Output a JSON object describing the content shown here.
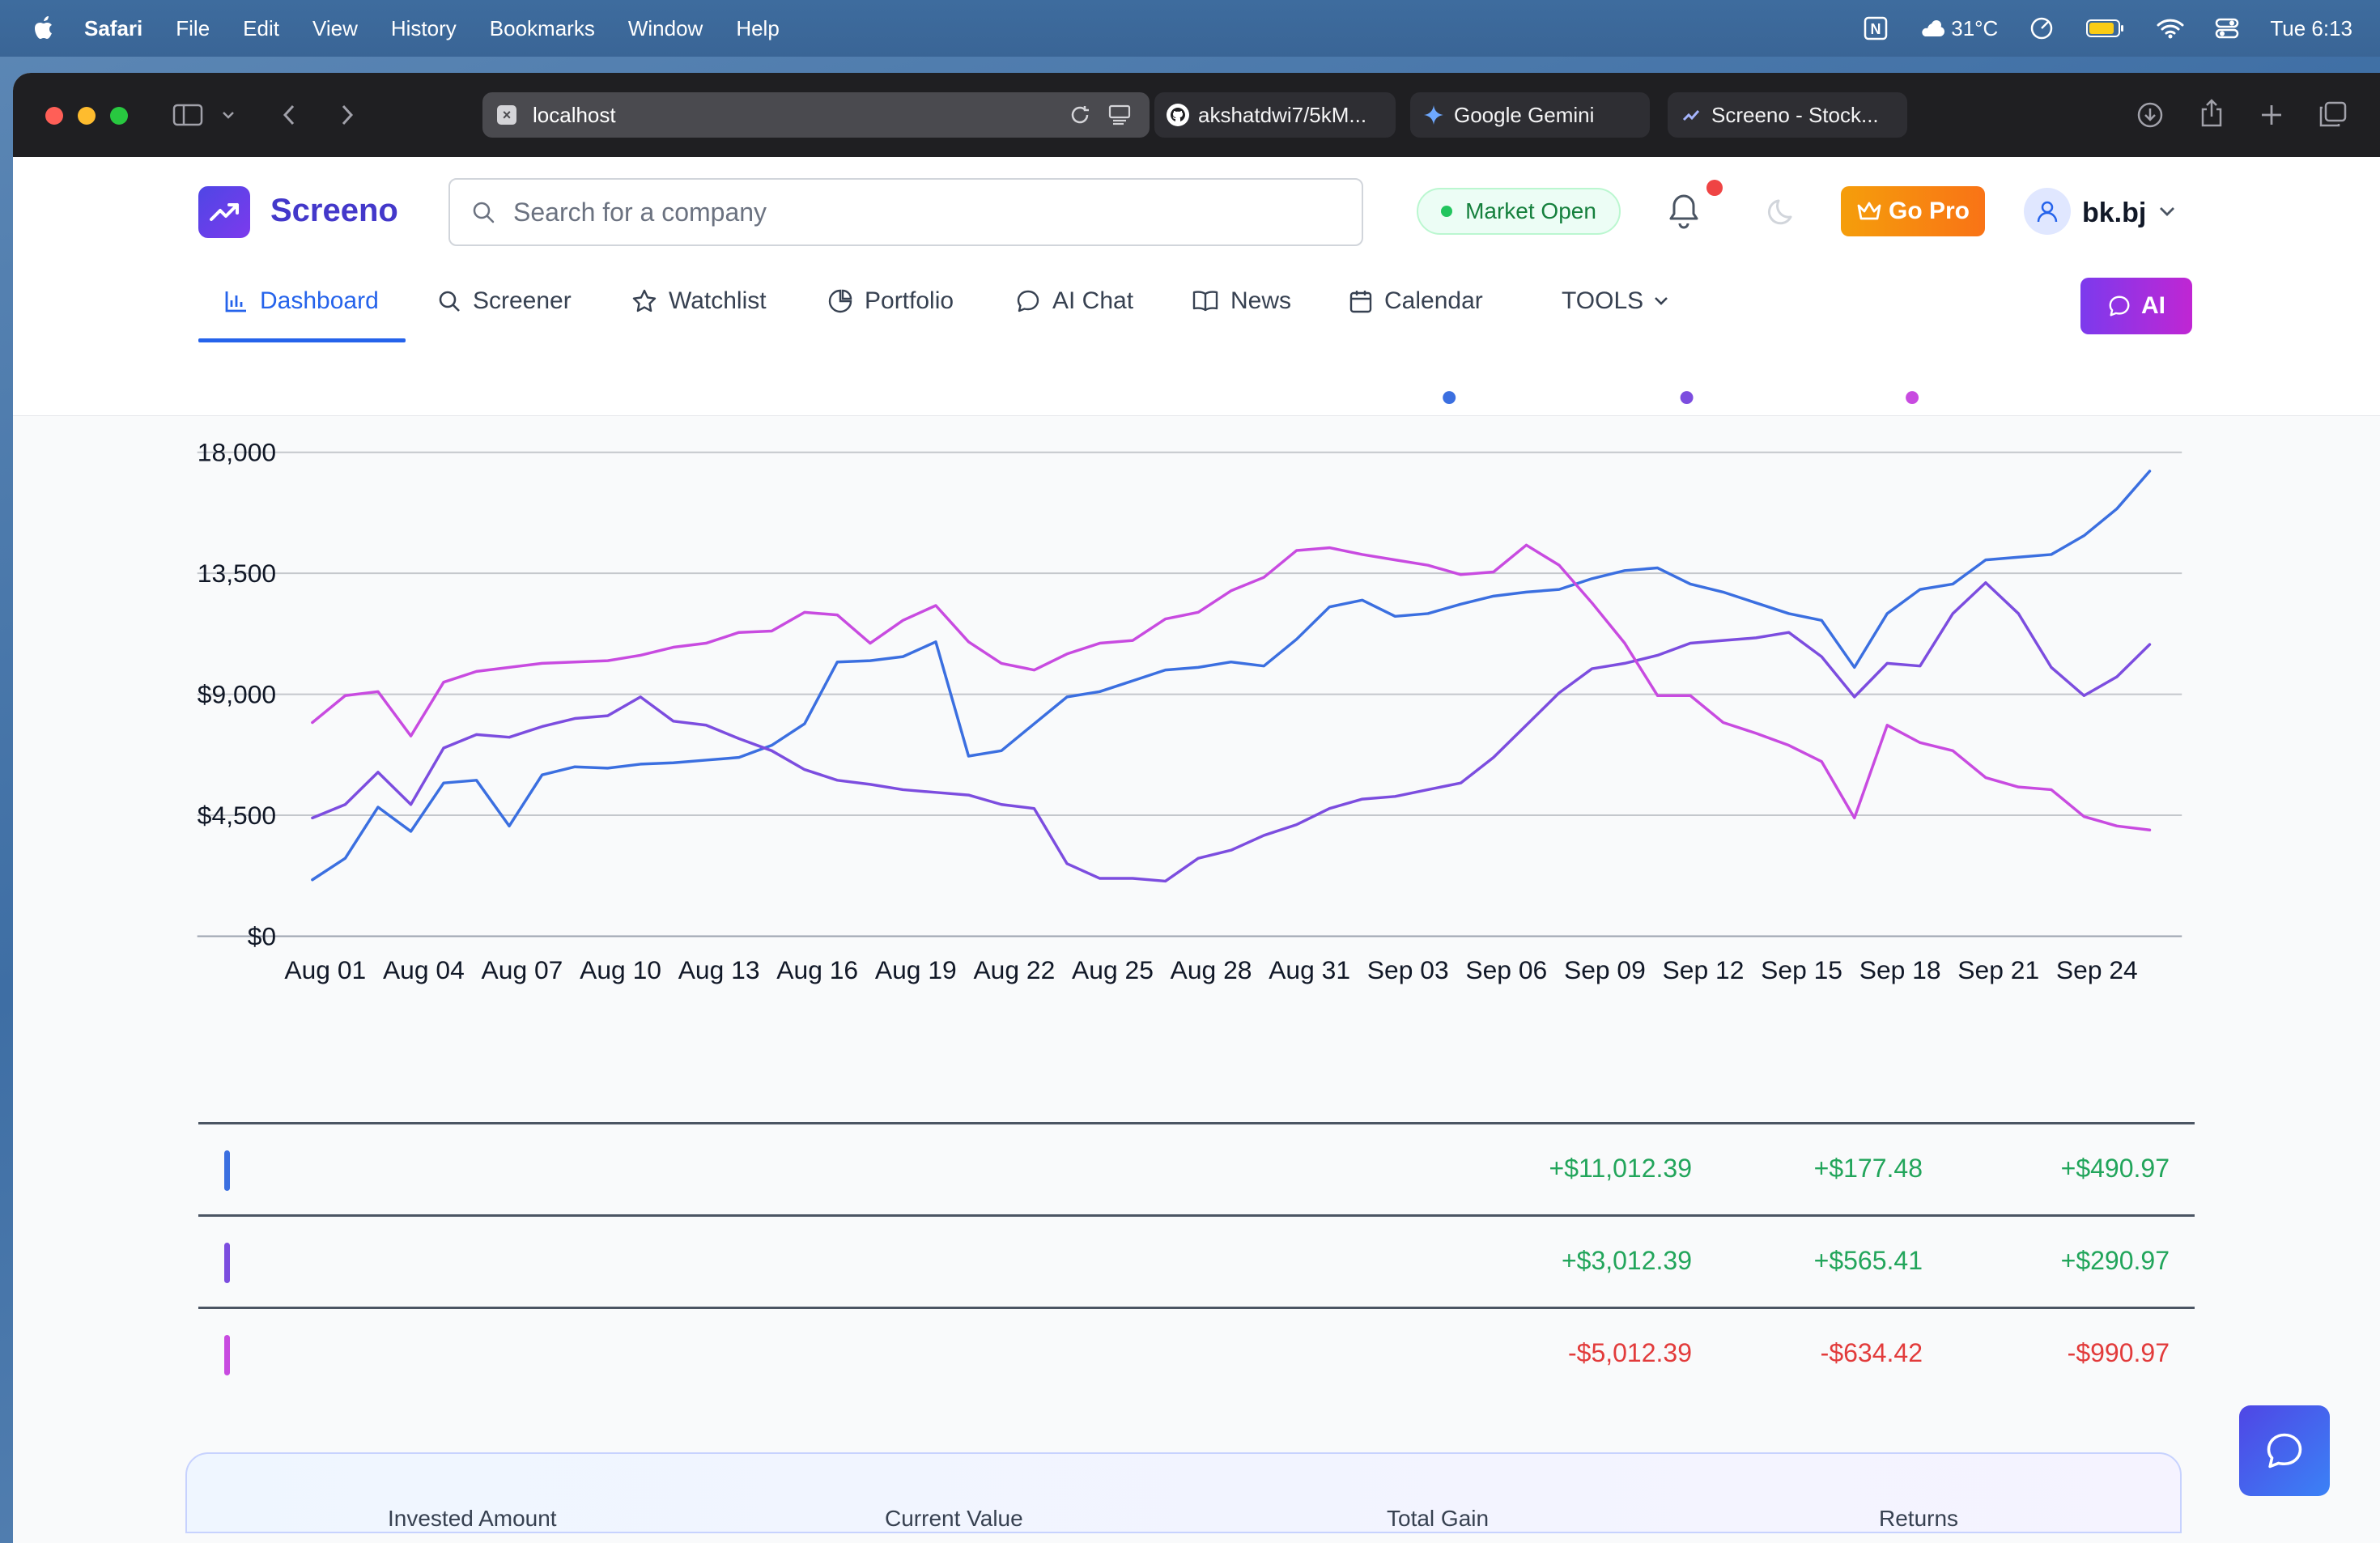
{
  "menubar": {
    "app": "Safari",
    "items": [
      "File",
      "Edit",
      "View",
      "History",
      "Bookmarks",
      "Window",
      "Help"
    ],
    "weather": "31°C",
    "clock": "Tue 6:13"
  },
  "browser": {
    "url": "localhost",
    "tabs": [
      {
        "label": "akshatdwi7/5kM..."
      },
      {
        "label": "Google Gemini"
      },
      {
        "label": "Screeno - Stock..."
      }
    ]
  },
  "app": {
    "logo": "Screeno",
    "search_placeholder": "Search for a company",
    "market_status": "Market Open",
    "go_pro": "Go Pro",
    "username": "bk.bj",
    "ai_button": "AI",
    "nav": [
      {
        "label": "Dashboard",
        "icon": "bar-chart-icon",
        "active": true
      },
      {
        "label": "Screener",
        "icon": "search-icon"
      },
      {
        "label": "Watchlist",
        "icon": "star-icon"
      },
      {
        "label": "Portfolio",
        "icon": "pie-chart-icon"
      },
      {
        "label": "AI Chat",
        "icon": "chat-bubble-icon"
      },
      {
        "label": "News",
        "icon": "book-icon"
      },
      {
        "label": "Calendar",
        "icon": "calendar-icon"
      },
      {
        "label": "TOOLS",
        "icon": "chevron-down-icon"
      }
    ]
  },
  "chart_data": {
    "type": "line",
    "yticks": [
      "$0",
      "$4,500",
      "$9,000",
      "13,500",
      "18,000"
    ],
    "ylim": [
      0,
      18000
    ],
    "x": [
      "Aug 01",
      "Aug 02",
      "Aug 03",
      "Aug 04",
      "Aug 05",
      "Aug 06",
      "Aug 07",
      "Aug 08",
      "Aug 09",
      "Aug 10",
      "Aug 11",
      "Aug 12",
      "Aug 13",
      "Aug 14",
      "Aug 15",
      "Aug 16",
      "Aug 17",
      "Aug 18",
      "Aug 19",
      "Aug 20",
      "Aug 21",
      "Aug 22",
      "Aug 23",
      "Aug 24",
      "Aug 25",
      "Aug 26",
      "Aug 27",
      "Aug 28",
      "Aug 29",
      "Aug 30",
      "Aug 31",
      "Sep 01",
      "Sep 02",
      "Sep 03",
      "Sep 04",
      "Sep 05",
      "Sep 06",
      "Sep 07",
      "Sep 08",
      "Sep 09",
      "Sep 10",
      "Sep 11",
      "Sep 12",
      "Sep 13",
      "Sep 14",
      "Sep 15",
      "Sep 16",
      "Sep 17",
      "Sep 18",
      "Sep 19",
      "Sep 20",
      "Sep 21",
      "Sep 22",
      "Sep 23",
      "Sep 24",
      "Sep 25",
      "Sep 26"
    ],
    "xticks": [
      "Aug 01",
      "Aug 04",
      "Aug 07",
      "Aug 10",
      "Aug 13",
      "Aug 16",
      "Aug 19",
      "Aug 22",
      "Aug 25",
      "Aug 28",
      "Aug 31",
      "Sep 03",
      "Sep 06",
      "Sep 09",
      "Sep 12",
      "Sep 15",
      "Sep 18",
      "Sep 21",
      "Sep 24"
    ],
    "series": [
      {
        "color": "#3b6fe0",
        "values": [
          2100,
          2900,
          4800,
          3900,
          5700,
          5800,
          4100,
          6000,
          6300,
          6250,
          6400,
          6450,
          6550,
          6650,
          7100,
          7900,
          10200,
          10250,
          10400,
          10950,
          6700,
          6900,
          7900,
          8900,
          9100,
          9500,
          9900,
          10000,
          10200,
          10050,
          11050,
          12250,
          12500,
          11900,
          12000,
          12350,
          12650,
          12800,
          12900,
          13300,
          13600,
          13700,
          13100,
          12800,
          12400,
          12000,
          11750,
          10000,
          12000,
          12900,
          13100,
          14000,
          14100,
          14200,
          14900,
          15900,
          17300
        ]
      },
      {
        "color": "#7c4ddf",
        "values": [
          4400,
          4900,
          6100,
          4900,
          7000,
          7500,
          7400,
          7800,
          8100,
          8200,
          8900,
          8000,
          7850,
          7350,
          6900,
          6200,
          5800,
          5650,
          5450,
          5350,
          5250,
          4900,
          4750,
          2700,
          2150,
          2150,
          2050,
          2900,
          3200,
          3750,
          4150,
          4750,
          5100,
          5200,
          5450,
          5700,
          6650,
          7850,
          9050,
          9950,
          10150,
          10450,
          10900,
          11000,
          11100,
          11300,
          10400,
          8900,
          10150,
          10050,
          12000,
          13150,
          12000,
          10000,
          8950,
          9650,
          10850
        ]
      },
      {
        "color": "#c84be0",
        "values": [
          7950,
          8950,
          9100,
          7450,
          9450,
          9850,
          10000,
          10150,
          10200,
          10250,
          10450,
          10750,
          10900,
          11300,
          11350,
          12050,
          11950,
          10900,
          11750,
          12300,
          10950,
          10150,
          9900,
          10500,
          10900,
          11000,
          11800,
          12050,
          12850,
          13350,
          14350,
          14450,
          14200,
          14000,
          13800,
          13450,
          13550,
          14550,
          13800,
          12400,
          10900,
          8950,
          8950,
          7950,
          7550,
          7100,
          6500,
          4400,
          7850,
          7200,
          6900,
          5900,
          5550,
          5450,
          4450,
          4100,
          3950
        ]
      }
    ]
  },
  "holdings": [
    {
      "color": "#3b6fe0",
      "values": [
        "+$11,012.39",
        "+$177.48",
        "+$490.97"
      ],
      "sign": "pos"
    },
    {
      "color": "#7c4ddf",
      "values": [
        "+$3,012.39",
        "+$565.41",
        "+$290.97"
      ],
      "sign": "pos"
    },
    {
      "color": "#c84be0",
      "values": [
        "-$5,012.39",
        "-$634.42",
        "-$990.97"
      ],
      "sign": "neg"
    }
  ],
  "summary": {
    "labels": [
      "Invested Amount",
      "Current Value",
      "Total Gain",
      "Returns"
    ]
  },
  "colors": {
    "positive": "#22a55b",
    "negative": "#e23b3b",
    "accent": "#2563eb"
  }
}
